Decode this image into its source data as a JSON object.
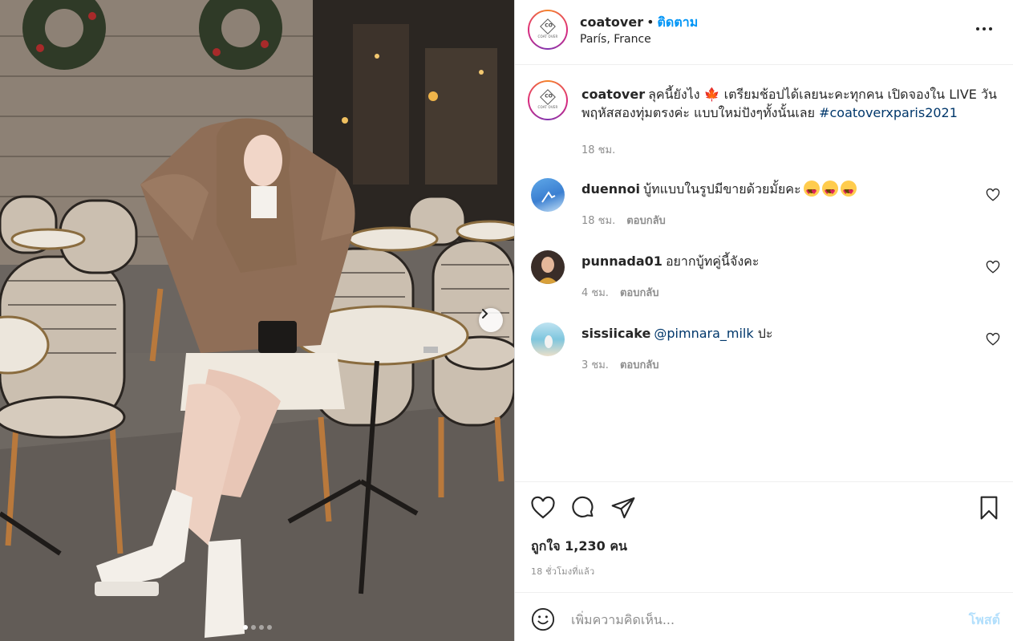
{
  "post": {
    "username": "coatover",
    "separator": "•",
    "follow_label": "ติดตาม",
    "location": "París, France",
    "logo_mark": "CO",
    "logo_text": "COAT OVER",
    "caption": {
      "username": "coatover",
      "text": "ลุคนี้ยังไง 🍁 เตรียมช้อปได้เลยนะคะทุกคน เปิดจองใน LIVE วันพฤหัสสองทุ่มตรงค่ะ แบบใหม่ปังๆทั้งนั้นเลย",
      "hashtag": "#coatoverxparis2021",
      "time": "18 ชม."
    },
    "comments": [
      {
        "username": "duennoi",
        "text": "บู้ทแบบในรูปมีขายด้วยมั้ยคะ",
        "emoji_count": 3,
        "time": "18 ชม.",
        "reply_label": "ตอบกลับ",
        "avatar_icon": "sky-photo-avatar"
      },
      {
        "username": "punnada01",
        "text": "อยากบู้ทคู่นี้จังคะ",
        "time": "4 ชม.",
        "reply_label": "ตอบกลับ",
        "avatar_icon": "portrait-avatar"
      },
      {
        "username": "sissiicake",
        "mention": "@pimnara_milk",
        "text": " ปะ",
        "time": "3 ชม.",
        "reply_label": "ตอบกลับ",
        "avatar_icon": "beach-photo-avatar"
      }
    ],
    "likes_text": "ถูกใจ 1,230 คน",
    "time_ago": "18 ชั่วโมงที่แล้ว",
    "comment_placeholder": "เพิ่มความคิดเห็น...",
    "post_button": "โพสต์",
    "carousel": {
      "count": 4,
      "active": 0
    }
  },
  "icons": [
    "heart-icon",
    "comment-icon",
    "share-icon",
    "bookmark-icon",
    "smile-icon",
    "more-icon",
    "next-arrow-icon"
  ],
  "colors": {
    "link": "#0095f6",
    "hashtag": "#00376b",
    "muted": "#8e8e8e",
    "post_disabled": "#b2dffc"
  }
}
